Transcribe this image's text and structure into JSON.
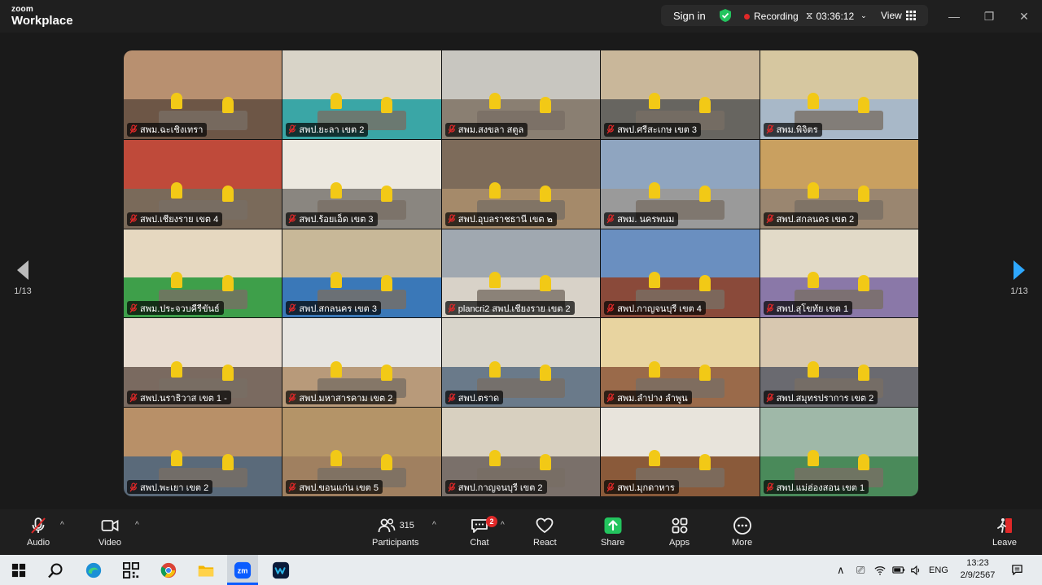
{
  "app": {
    "logo_line1": "zoom",
    "logo_line2": "Workplace"
  },
  "topbar": {
    "signin_label": "Sign in",
    "recording_label": "Recording",
    "timer": "03:36:12",
    "view_label": "View"
  },
  "pager": {
    "left": "1/13",
    "right": "1/13"
  },
  "tiles": [
    {
      "name": "สพม.ฉะเชิงเทรา",
      "wall": "#b89070",
      "floor": "#6d5646"
    },
    {
      "name": "สพป.ยะลา เขต 2",
      "wall": "#d9d4c8",
      "floor": "#3aa6a6"
    },
    {
      "name": "สพม.สงขลา สตูล",
      "wall": "#c8c6c0",
      "floor": "#8a7f72"
    },
    {
      "name": "สพป.ศรีสะเกษ เขต 3",
      "wall": "#c9b79a",
      "floor": "#676560"
    },
    {
      "name": "สพม.พิจิตร",
      "wall": "#d6c7a0",
      "floor": "#a8b8c8"
    },
    {
      "name": "สพป.เชียงราย เขต 4",
      "wall": "#bf4a3a",
      "floor": "#7a6a5a"
    },
    {
      "name": "สพป.ร้อยเอ็ด เขต 3",
      "wall": "#ece8df",
      "floor": "#8a8680"
    },
    {
      "name": "สพป.อุบลราชธานี เขต ๒",
      "wall": "#7d6b5a",
      "floor": "#a58a6a"
    },
    {
      "name": "สพม. นครพนม",
      "wall": "#8fa5c0",
      "floor": "#9a9a9a"
    },
    {
      "name": "สพป.สกลนคร เขต 2",
      "wall": "#c9a060",
      "floor": "#9a8670"
    },
    {
      "name": "สพม.ประจวบคีรีขันธ์",
      "wall": "#e6d8c0",
      "floor": "#3e9f4a"
    },
    {
      "name": "สพป.สกลนคร เขต 3",
      "wall": "#c8b898",
      "floor": "#3a78b8"
    },
    {
      "name": "plancri2 สพป.เชียงราย เขต 2",
      "wall": "#a0a8b0",
      "floor": "#d8d2c8"
    },
    {
      "name": "สพป.กาญจนบุรี เขต 4",
      "wall": "#6a8fc0",
      "floor": "#8a4a3a"
    },
    {
      "name": "สพป.สุโขทัย เขต 1",
      "wall": "#e2dac8",
      "floor": "#8a78a8"
    },
    {
      "name": "สพป.นราธิวาส เขต 1 -",
      "wall": "#e8dcd0",
      "floor": "#7a6a60"
    },
    {
      "name": "สพป.มหาสารคาม เขต 2",
      "wall": "#e6e4e0",
      "floor": "#b89a7a"
    },
    {
      "name": "สพป.ตราด",
      "wall": "#d8d4ca",
      "floor": "#6a7a8a"
    },
    {
      "name": "สพม.ลำปาง ลำพูน",
      "wall": "#e8d4a0",
      "floor": "#9a6a4a"
    },
    {
      "name": "สพป.สมุทรปราการ เขต 2",
      "wall": "#d8c8b0",
      "floor": "#6a6a70"
    },
    {
      "name": "สพป.พะเยา เขต 2",
      "wall": "#b89068",
      "floor": "#5a6a7a"
    },
    {
      "name": "สพป.ขอนแก่น เขต 5",
      "wall": "#b49468",
      "floor": "#a08060"
    },
    {
      "name": "สพป.กาญจนบุรี เขต 2",
      "wall": "#d8d0c0",
      "floor": "#7a706a"
    },
    {
      "name": "สพป.มุกดาหาร",
      "wall": "#e8e4dc",
      "floor": "#8a5a3a"
    },
    {
      "name": "สพป.แม่ฮ่องสอน เขต 1",
      "wall": "#9fb8a8",
      "floor": "#4a8a5a"
    }
  ],
  "toolbar": {
    "audio": "Audio",
    "video": "Video",
    "participants": "Participants",
    "participants_count": "315",
    "chat": "Chat",
    "chat_badge": "2",
    "react": "React",
    "share": "Share",
    "apps": "Apps",
    "more": "More",
    "leave": "Leave"
  },
  "taskbar": {
    "lang": "ENG",
    "time": "13:23",
    "date": "2/9/2567"
  }
}
